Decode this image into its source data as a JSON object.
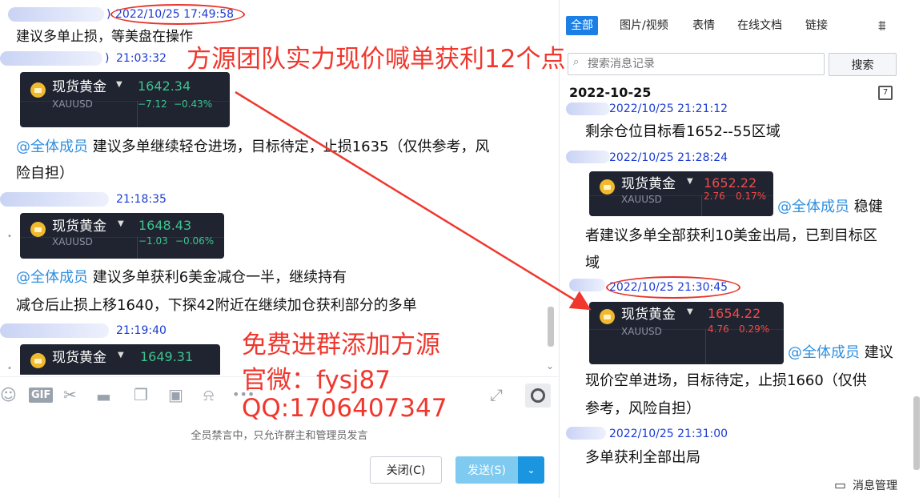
{
  "left": {
    "messages": [
      {
        "time": "2022/10/25 17:49:58",
        "text": "建议多单止损，等美盘在操作"
      },
      {
        "time": "21:03:32",
        "card": {
          "name": "现货黄金",
          "symbol": "XAUUSD",
          "price": "1642.34",
          "change": "−7.12",
          "percent": "−0.43%",
          "direction": "down"
        },
        "mention": "@全体成员",
        "text1": " 建议多单继续轻仓进场，目标待定，止损1635（仅供参考，风",
        "text2": "险自担）"
      },
      {
        "time": "21:18:35",
        "card": {
          "name": "现货黄金",
          "symbol": "XAUUSD",
          "price": "1648.43",
          "change": "−1.03",
          "percent": "−0.06%",
          "direction": "down"
        },
        "mention": "@全体成员",
        "text1": " 建议多单获利6美金减仓一半，继续持有",
        "text2": "减仓后止损上移1640，下探42附近在继续加仓获利部分的多单"
      },
      {
        "time": "21:19:40",
        "card": {
          "name": "现货黄金",
          "price": "1649.31"
        }
      }
    ],
    "overlay": {
      "headline": "方源团队实力现价喊单获利12个点",
      "promo1": "免费进群添加方源",
      "promo2": "官微：fysj87",
      "promo3": "QQ:1706407347"
    },
    "toolbar": {
      "tools": [
        "emoji-icon",
        "gif-icon",
        "scissors-icon",
        "folder-icon",
        "sticker-icon",
        "image-icon",
        "bell-icon",
        "more-icon"
      ],
      "gif_label": "GIF",
      "notice": "全员禁言中，只允许群主和管理员发言",
      "close_label": "关闭(C)",
      "send_label": "发送(S)"
    }
  },
  "right": {
    "tabs": [
      "全部",
      "图片/视频",
      "表情",
      "在线文档",
      "链接"
    ],
    "active_tab": "全部",
    "search_placeholder": "搜索消息记录",
    "search_button": "搜索",
    "date_header": "2022-10-25",
    "messages": [
      {
        "time": "2022/10/25 21:21:12",
        "text": "剩余仓位目标看1652--55区域"
      },
      {
        "time": "2022/10/25 21:28:24",
        "card": {
          "name": "现货黄金",
          "symbol": "XAUUSD",
          "price": "1652.22",
          "change": "2.76",
          "percent": "0.17%",
          "direction": "up"
        },
        "mention": "@全体成员",
        "text0": " 稳健",
        "text1": "者建议多单全部获利10美金出局，已到目标区",
        "text2": "域"
      },
      {
        "time": "2022/10/25 21:30:45",
        "card": {
          "name": "现货黄金",
          "symbol": "XAUUSD",
          "price": "1654.22",
          "change": "4.76",
          "percent": "0.29%",
          "direction": "up"
        },
        "mention": "@全体成员",
        "text0": " 建议",
        "text1": "现价空单进场，目标待定，止损1660（仅供",
        "text2": "参考，风险自担）"
      },
      {
        "time": "2022/10/25 21:31:00",
        "text": "多单获利全部出局"
      }
    ],
    "footer": "消息管理"
  },
  "colors": {
    "accent": "#1b7fe6",
    "annotation": "#f0372d",
    "timestamp": "#1b3bd1",
    "mention": "#2f8fe0",
    "up": "#ef4b48",
    "down": "#3ec38f",
    "card_bg": "#1f2430"
  }
}
